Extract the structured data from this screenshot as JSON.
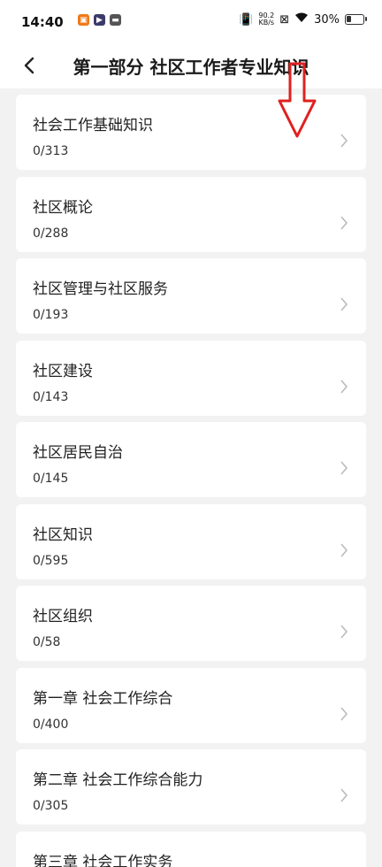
{
  "status": {
    "time": "14:40",
    "net_speed_value": "90.2",
    "net_speed_unit": "KB/s",
    "battery": "30%",
    "battery_level": 0.3
  },
  "header": {
    "title": "第一部分  社区工作者专业知识"
  },
  "items": [
    {
      "title": "社会工作基础知识",
      "count": "0/313"
    },
    {
      "title": "社区概论",
      "count": "0/288"
    },
    {
      "title": "社区管理与社区服务",
      "count": "0/193"
    },
    {
      "title": "社区建设",
      "count": "0/143"
    },
    {
      "title": "社区居民自治",
      "count": "0/145"
    },
    {
      "title": "社区知识",
      "count": "0/595"
    },
    {
      "title": "社区组织",
      "count": "0/58"
    },
    {
      "title": "第一章 社会工作综合",
      "count": "0/400"
    },
    {
      "title": "第二章 社会工作综合能力",
      "count": "0/305"
    },
    {
      "title": "第三章 社会工作实务",
      "count": ""
    }
  ],
  "colors": {
    "annotation_arrow": "#e02020",
    "background": "#f2f2f2",
    "card": "#ffffff"
  }
}
